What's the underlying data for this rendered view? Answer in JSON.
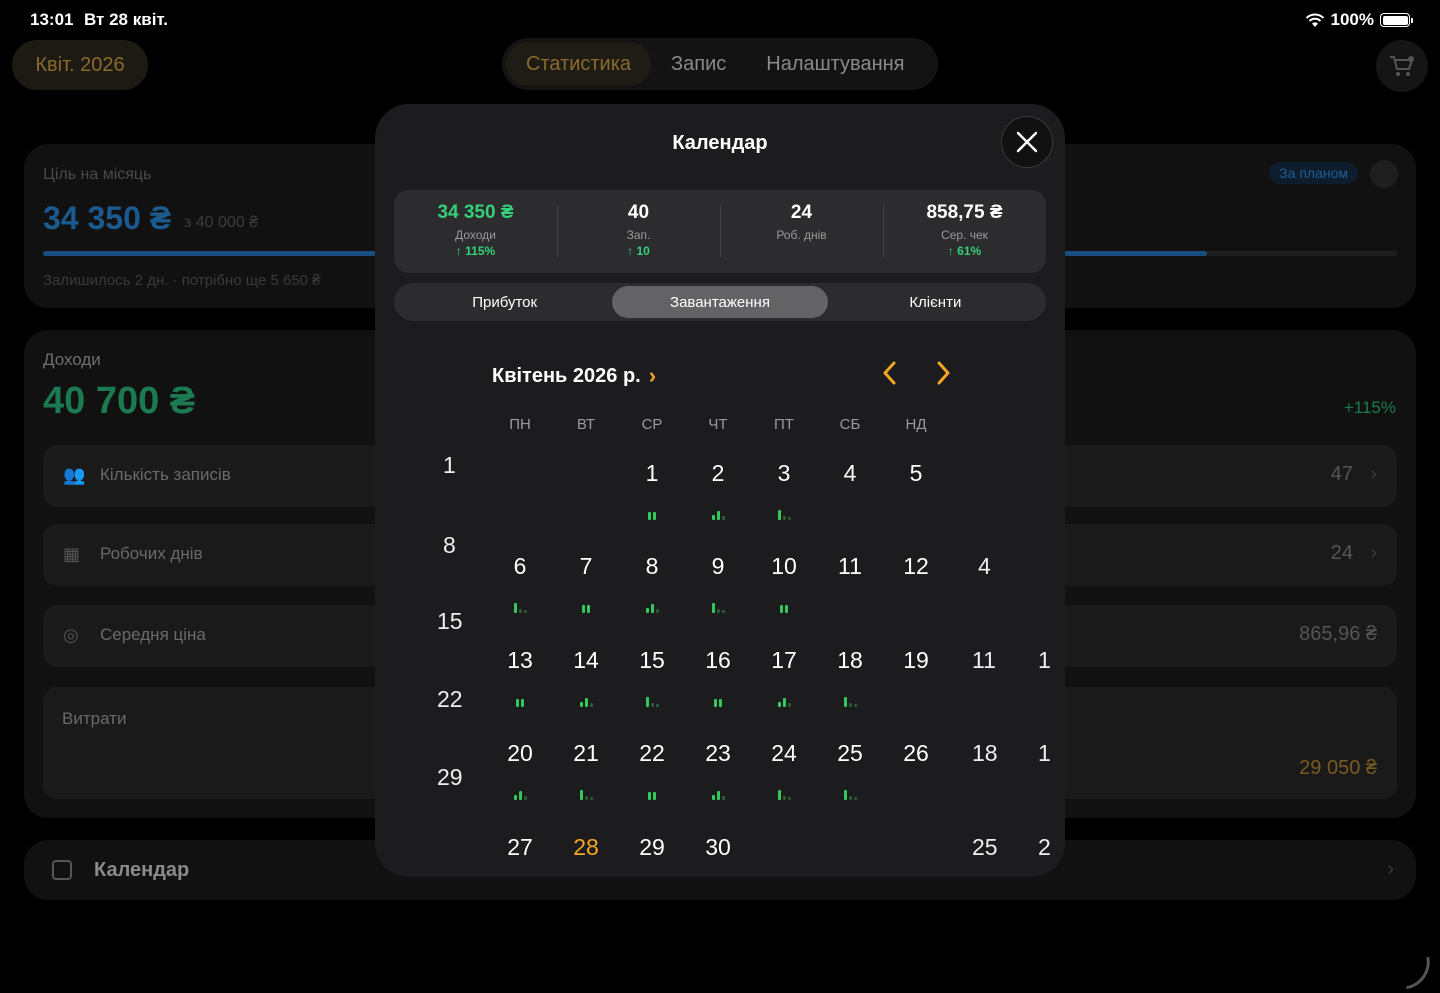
{
  "status": {
    "time": "13:01",
    "date": "Вт 28 квіт.",
    "battery": "100%"
  },
  "nav": {
    "month": "Квіт. 2026",
    "tabs": [
      "Статистика",
      "Запис",
      "Налаштування"
    ]
  },
  "goal": {
    "label": "Ціль на місяць",
    "value": "34 350 ₴",
    "of": "з 40 000 ₴",
    "remaining": "Залишилось 2 дн. · потрібно ще 5 650 ₴",
    "badge": "За планом",
    "progress_fraction": 0.86
  },
  "income": {
    "label": "Доходи",
    "value": "40 700 ₴",
    "pct": "+115%",
    "rows": [
      {
        "label": "Кількість записів",
        "value": "47"
      },
      {
        "label": "Робочих днів",
        "value": "24"
      },
      {
        "label": "Середня ціна",
        "value": "865,96 ₴"
      }
    ],
    "expenses": {
      "label": "Витрати",
      "value": "29 050 ₴"
    }
  },
  "calendar_card": {
    "label": "Календар"
  },
  "modal": {
    "title": "Календар",
    "stats": [
      {
        "value": "34 350 ₴",
        "label": "Доходи",
        "delta": "↑ 115%"
      },
      {
        "value": "40",
        "label": "Зап.",
        "delta": "↑ 10"
      },
      {
        "value": "24",
        "label": "Роб. днів",
        "delta": ""
      },
      {
        "value": "858,75 ₴",
        "label": "Сер. чек",
        "delta": "↑ 61%"
      }
    ],
    "segments": [
      "Прибуток",
      "Завантаження",
      "Клієнти"
    ],
    "active_segment": 1,
    "month_title": "Квітень 2026 р.",
    "weekdays": [
      "ПН",
      "ВТ",
      "СР",
      "ЧТ",
      "ПТ",
      "СБ",
      "НД"
    ],
    "today": "28",
    "weeks": [
      [
        "",
        "",
        "1",
        "2",
        "3",
        "4",
        "5"
      ],
      [
        "6",
        "7",
        "8",
        "9",
        "10",
        "11",
        "12"
      ],
      [
        "13",
        "14",
        "15",
        "16",
        "17",
        "18",
        "19"
      ],
      [
        "20",
        "21",
        "22",
        "23",
        "24",
        "25",
        "26"
      ],
      [
        "27",
        "28",
        "29",
        "30",
        "",
        "",
        ""
      ]
    ],
    "load_levels": [
      [
        null,
        null,
        2,
        3,
        1,
        null,
        null
      ],
      [
        1,
        2,
        3,
        1,
        2,
        null,
        null
      ],
      [
        2,
        3,
        1,
        2,
        3,
        1,
        null
      ],
      [
        3,
        1,
        2,
        3,
        1,
        1,
        null
      ],
      [
        null,
        null,
        null,
        null,
        null,
        null,
        null
      ]
    ],
    "ghost_left": [
      "1",
      "8",
      "15",
      "22",
      "29"
    ],
    "ghost_right": [
      "4",
      "11",
      "18",
      "25"
    ],
    "ghost_far_right": [
      "1",
      "1",
      "2"
    ]
  }
}
